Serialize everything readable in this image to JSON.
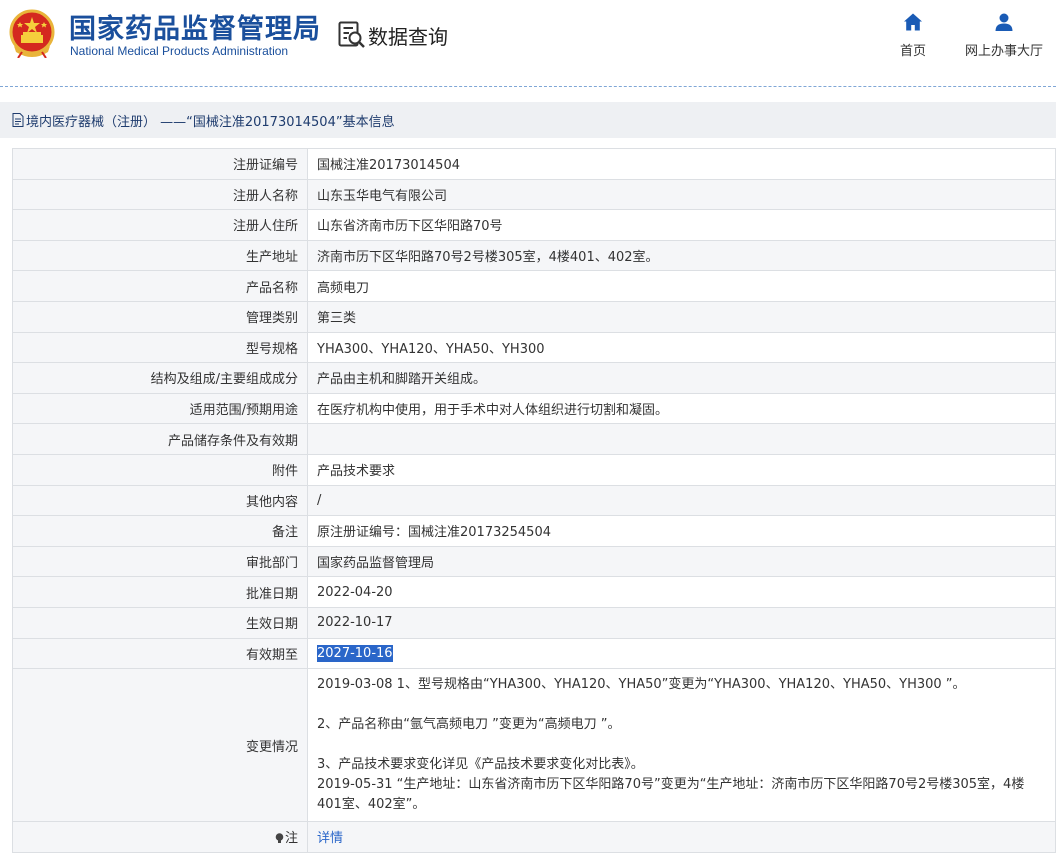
{
  "header": {
    "agency_cn": "国家药品监督管理局",
    "agency_en": "National Medical Products Administration",
    "data_query": "数据查询",
    "nav": {
      "home": "首页",
      "online_hall": "网上办事大厅"
    }
  },
  "title": "境内医疗器械（注册） ——“国械注准20173014504”基本信息",
  "rows": [
    {
      "label": "注册证编号",
      "value": "国械注准20173014504"
    },
    {
      "label": "注册人名称",
      "value": "山东玉华电气有限公司"
    },
    {
      "label": "注册人住所",
      "value": "山东省济南市历下区华阳路70号"
    },
    {
      "label": "生产地址",
      "value": "济南市历下区华阳路70号2号楼305室，4楼401、402室。"
    },
    {
      "label": "产品名称",
      "value": "高频电刀"
    },
    {
      "label": "管理类别",
      "value": "第三类"
    },
    {
      "label": "型号规格",
      "value": "YHA300、YHA120、YHA50、YH300"
    },
    {
      "label": "结构及组成/主要组成成分",
      "value": "产品由主机和脚踏开关组成。"
    },
    {
      "label": "适用范围/预期用途",
      "value": "在医疗机构中使用，用于手术中对人体组织进行切割和凝固。"
    },
    {
      "label": "产品储存条件及有效期",
      "value": ""
    },
    {
      "label": "附件",
      "value": "产品技术要求"
    },
    {
      "label": "其他内容",
      "value": "/"
    },
    {
      "label": "备注",
      "value": "原注册证编号：国械注准20173254504"
    },
    {
      "label": "审批部门",
      "value": "国家药品监督管理局"
    },
    {
      "label": "批准日期",
      "value": "2022-04-20"
    },
    {
      "label": "生效日期",
      "value": "2022-10-17"
    },
    {
      "label": "有效期至",
      "value": "2027-10-16"
    }
  ],
  "change": {
    "label": "变更情况",
    "line1": "2019-03-08 1、型号规格由“YHA300、YHA120、YHA50”变更为“YHA300、YHA120、YHA50、YH300 ”。",
    "line2": "2、产品名称由“氩气高频电刀 ”变更为“高频电刀 ”。",
    "line3": "3、产品技术要求变化详见《产品技术要求变化对比表》。",
    "line4": "2019-05-31 “生产地址：山东省济南市历下区华阳路70号”变更为“生产地址：济南市历下区华阳路70号2号楼305室，4楼401室、402室”。"
  },
  "note": {
    "label": "注",
    "link": "详情"
  }
}
